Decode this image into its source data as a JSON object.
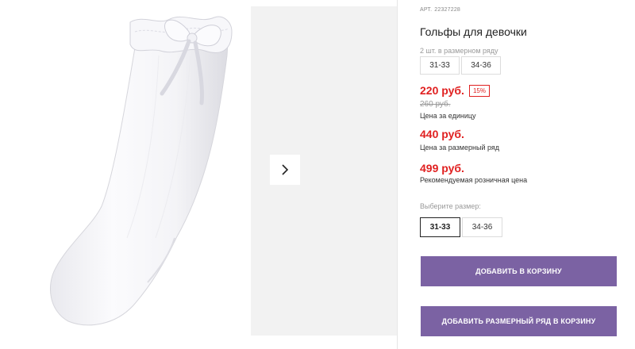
{
  "product": {
    "sku_label": "АРТ.",
    "sku": "22327228",
    "title": "Гольфы для девочки",
    "image": "white-knee-socks-with-bow"
  },
  "pack": {
    "label": "2 шт. в размерном ряду",
    "sizes": [
      "31-33",
      "34-36"
    ]
  },
  "prices": {
    "unit_price": "220 руб.",
    "discount": "15%",
    "old_price": "260 руб.",
    "unit_caption": "Цена за единицу",
    "pack_price": "440 руб.",
    "pack_caption": "Цена за размерный ряд",
    "rrp_price": "499 руб.",
    "rrp_caption": "Рекомендуемая розничная цена"
  },
  "size_picker": {
    "label": "Выберите размер:",
    "options": [
      "31-33",
      "34-36"
    ],
    "selected": "31-33"
  },
  "buttons": {
    "add_to_cart": "ДОБАВИТЬ В КОРЗИНУ",
    "add_pack_to_cart": "ДОБАВИТЬ РАЗМЕРНЫЙ РЯД В КОРЗИНУ"
  },
  "colors": {
    "accent": "#7b62a3",
    "price": "#e02020"
  },
  "icons": {
    "next": "chevron-right-icon"
  }
}
